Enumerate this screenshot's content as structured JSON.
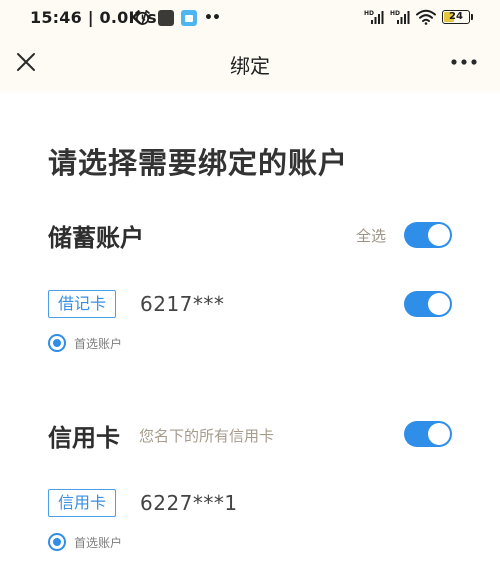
{
  "status_bar": {
    "time": "15:46",
    "speed": "0.0K/s",
    "battery": "24"
  },
  "header": {
    "title": "绑定"
  },
  "page": {
    "heading": "请选择需要绑定的账户"
  },
  "savings": {
    "title": "储蓄账户",
    "select_all_label": "全选",
    "select_all_on": true,
    "cards": [
      {
        "type_label": "借记卡",
        "number": "6217***",
        "enabled": true,
        "primary_label": "首选账户",
        "primary": true
      }
    ]
  },
  "credit": {
    "title": "信用卡",
    "note": "您名下的所有信用卡",
    "toggle_on": true,
    "cards": [
      {
        "type_label": "信用卡",
        "number": "6227***1",
        "primary_label": "首选账户",
        "primary": true
      }
    ]
  },
  "colors": {
    "accent": "#2f8fe8",
    "header_bg": "#fdfbf4",
    "muted_text": "#9b9385"
  }
}
